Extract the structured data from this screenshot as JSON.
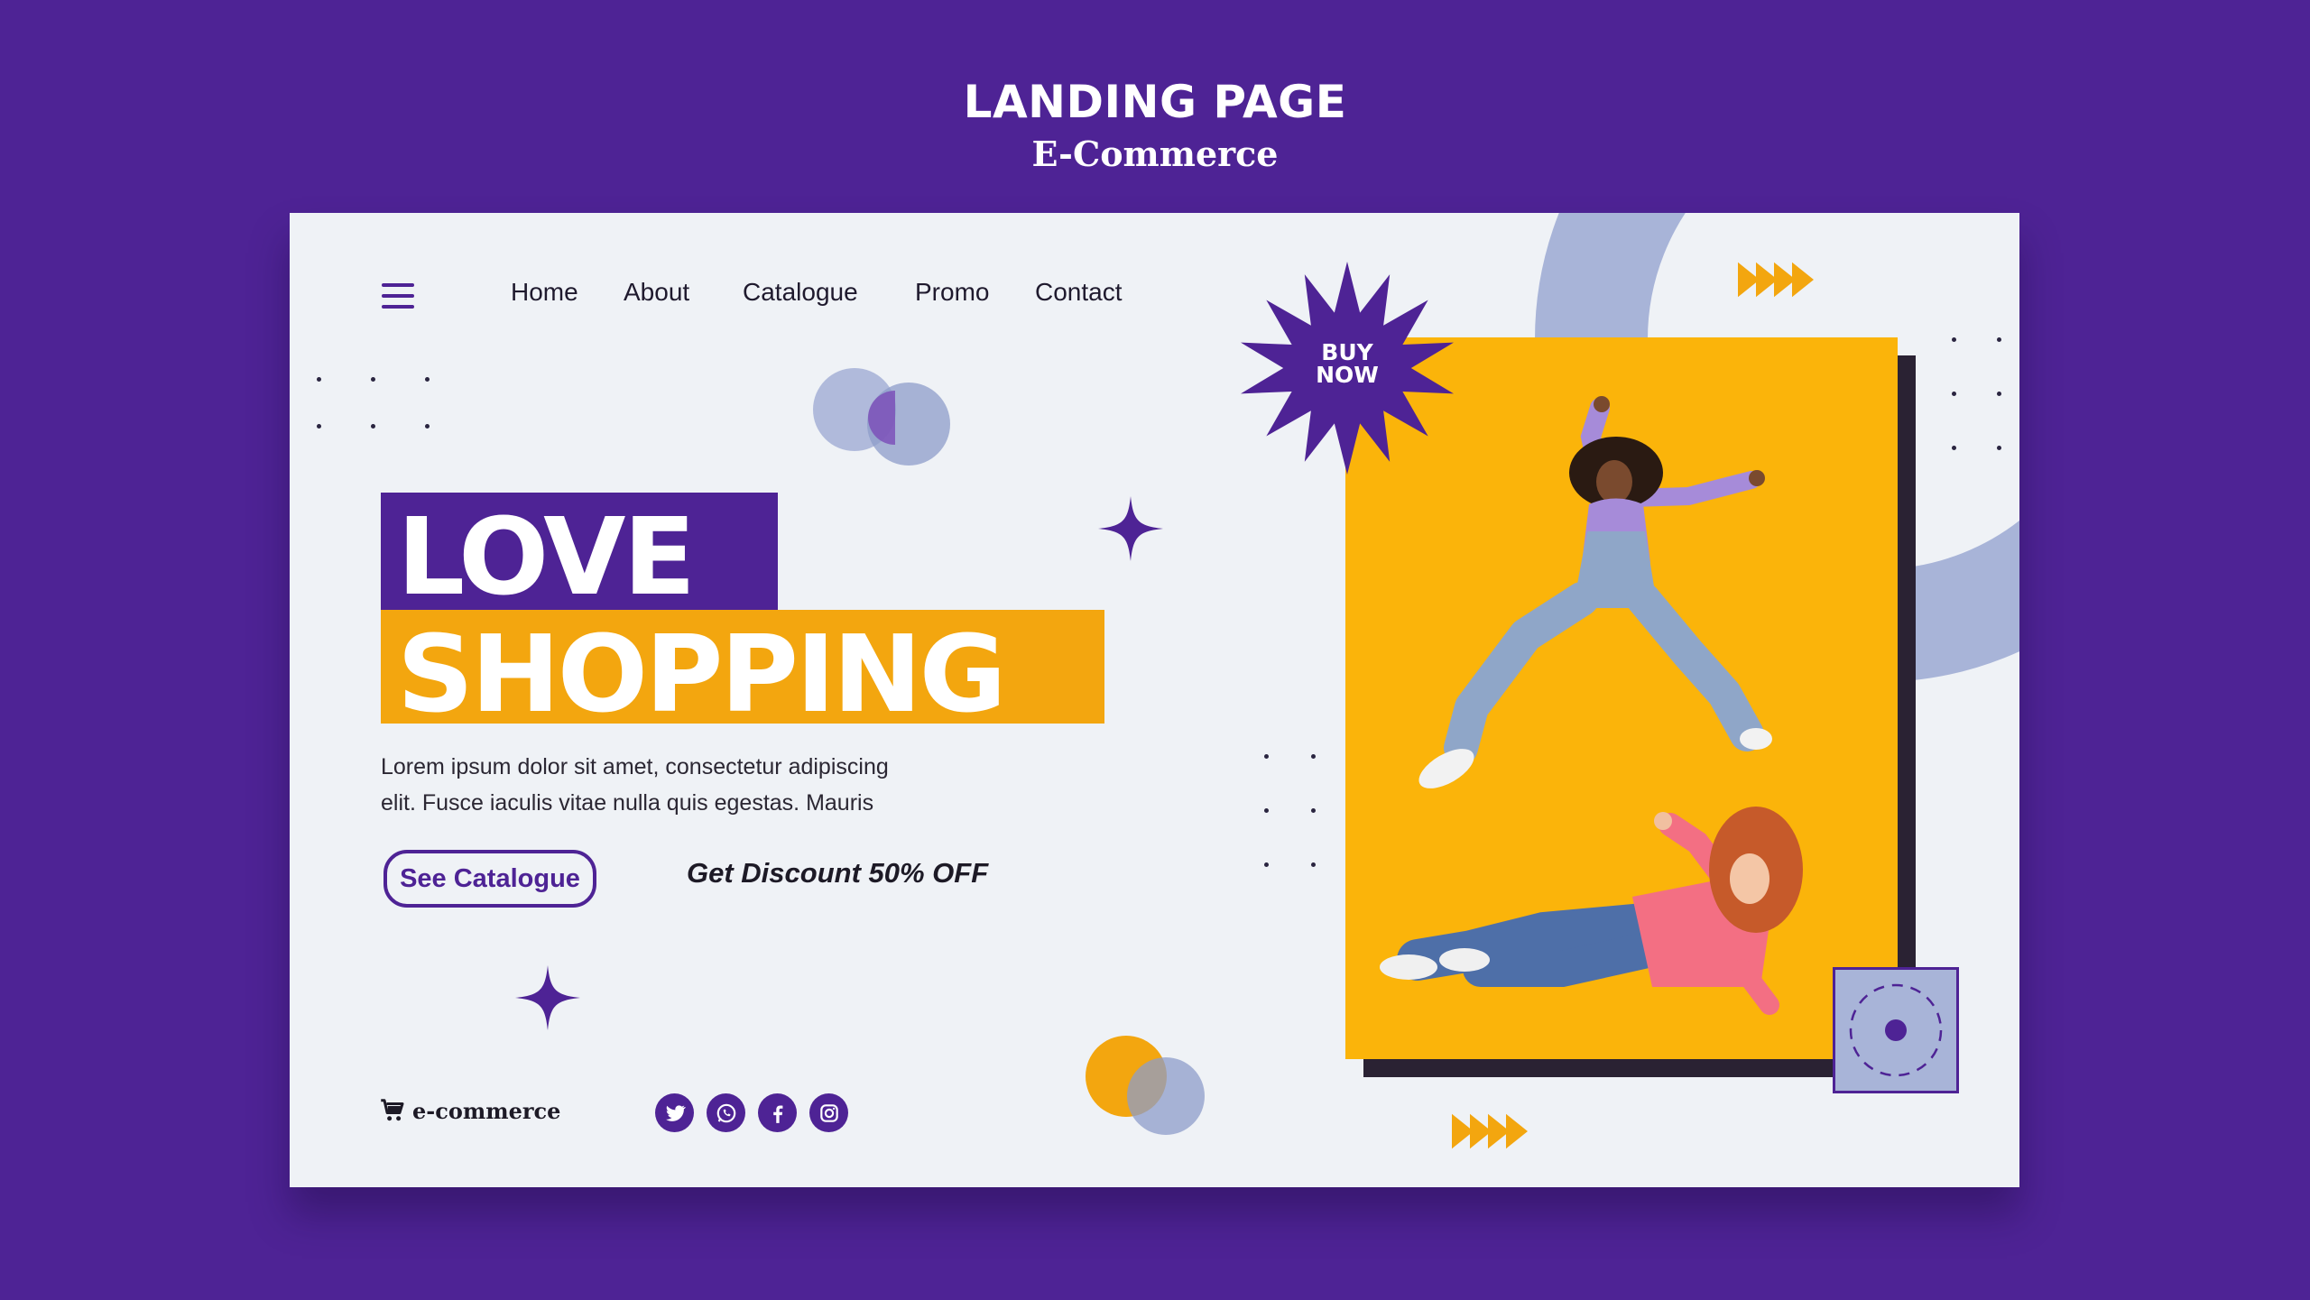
{
  "header": {
    "title": "LANDING PAGE",
    "subtitle": "E-Commerce"
  },
  "nav": {
    "menu_icon": "hamburger-icon",
    "items": [
      {
        "label": "Home"
      },
      {
        "label": "About"
      },
      {
        "label": "Catalogue"
      },
      {
        "label": "Promo"
      },
      {
        "label": "Contact"
      }
    ]
  },
  "hero": {
    "line1": "LOVE",
    "line2": "SHOPPING",
    "description_line1": "Lorem ipsum dolor sit amet, consectetur adipiscing",
    "description_line2": "elit. Fusce iaculis vitae nulla quis egestas. Mauris",
    "cta_label": "See Catalogue",
    "discount_text": "Get Discount 50% OFF"
  },
  "badge": {
    "line1": "BUY",
    "line2": "NOW"
  },
  "footer": {
    "brand": "e-commerce",
    "brand_icon": "cart-icon",
    "socials": [
      {
        "icon": "twitter-icon"
      },
      {
        "icon": "whatsapp-icon"
      },
      {
        "icon": "facebook-icon"
      },
      {
        "icon": "instagram-icon"
      }
    ]
  },
  "colors": {
    "background": "#4e2395",
    "card": "#eff2f6",
    "accent_purple": "#4e2395",
    "accent_orange": "#f3a60f",
    "photo_bg": "#fbb40a",
    "soft_blue": "#a8b4d8"
  }
}
